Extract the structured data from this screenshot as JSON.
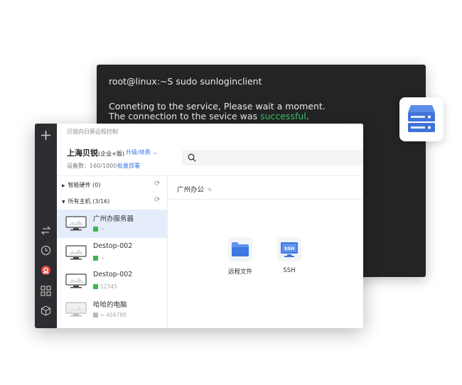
{
  "terminal": {
    "prompt_line": "root@linux:~S sudo sunloginclient",
    "line2": "Conneting to the service, Please wait a moment.",
    "line3_prefix": "The connection to the sevice was ",
    "line3_highlight": "successful",
    "line3_suffix": "."
  },
  "app": {
    "title": "贝锐向日葵远程控制",
    "company": "上海贝锐",
    "edition": "(企业+版)",
    "upgrade_label": "升级/续费",
    "device_count": "设备数：160/1000",
    "batch_deploy": "批量部署",
    "search_placeholder": ""
  },
  "groups": {
    "hardware": "智能硬件 (0)",
    "hosts": "所有主机 (3/16)"
  },
  "devices": [
    {
      "name": "广州办服务器",
      "sub": "~"
    },
    {
      "name": "Destop-002",
      "sub": "~"
    },
    {
      "name": "Destop-002",
      "sub": "12345"
    },
    {
      "name": "哈哈的电脑",
      "sub": "456788"
    }
  ],
  "panel": {
    "title": "广州办公",
    "tiles": [
      {
        "label": "远程文件",
        "icon": "folder-icon"
      },
      {
        "label": "SSH",
        "icon": "ssh-monitor-icon",
        "badge": "SSH"
      }
    ]
  },
  "colors": {
    "accent": "#3a74e8",
    "success": "#3ec46d",
    "sidebar": "#2c2d30",
    "terminal_bg": "#222426",
    "selected_row": "#e5edfb"
  }
}
